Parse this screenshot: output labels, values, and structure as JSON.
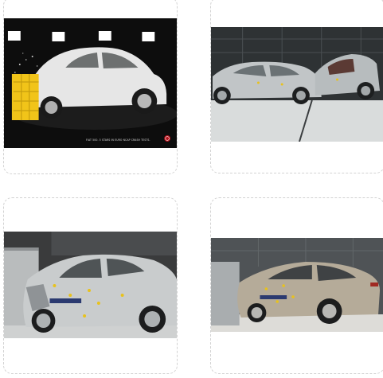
{
  "gallery": {
    "items": [
      {
        "id": "fiat-500-crash-test",
        "caption": "FIAT 500. 5 STARS IN EURO NCAP CRASH TESTS.",
        "colors": {
          "background": "#0d0d0d",
          "car": "#e8e8e8",
          "barrier": "#f1c419"
        }
      },
      {
        "id": "side-impact-crash-test",
        "colors": {
          "background": "#2e3234",
          "car": "#bfc3c5",
          "floor": "#d9dcdc"
        }
      },
      {
        "id": "small-overlap-silver-sedan",
        "colors": {
          "background": "#3a3b3c",
          "car": "#c9cccd",
          "barrier": "#b9bcbd"
        }
      },
      {
        "id": "small-overlap-gold-sedan",
        "colors": {
          "background": "#4f5356",
          "car": "#b5ab99",
          "floor": "#dddcd8"
        }
      }
    ]
  }
}
